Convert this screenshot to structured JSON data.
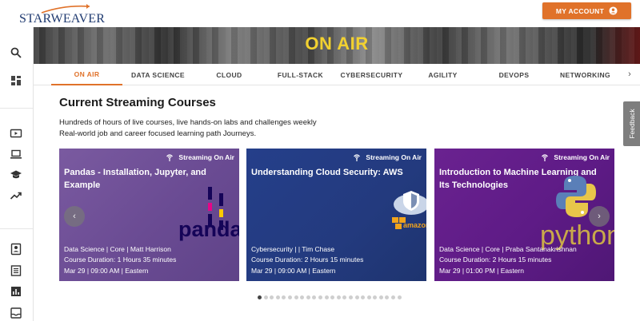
{
  "header": {
    "logo_text": "STARWEAVER",
    "account_label": "MY ACCOUNT"
  },
  "banner": {
    "title": "ON AIR"
  },
  "tabs": [
    {
      "label": "ON AIR",
      "active": true
    },
    {
      "label": "DATA SCIENCE"
    },
    {
      "label": "CLOUD"
    },
    {
      "label": "FULL-STACK"
    },
    {
      "label": "CYBERSECURITY"
    },
    {
      "label": "AGILITY"
    },
    {
      "label": "DEVOPS"
    },
    {
      "label": "NETWORKING"
    }
  ],
  "section": {
    "title": "Current Streaming Courses",
    "description": [
      "Hundreds of hours of live courses, live hands-on labs and challenges weekly",
      "Real-world job and career focused learning path Journeys."
    ]
  },
  "cards": [
    {
      "badge": "Streaming On Air",
      "title": "Pandas - Installation, Jupyter, and Example",
      "art_text": "pandas",
      "meta": [
        "Data Science | Core | Matt Harrison",
        "Course Duration: 1 Hours 35 minutes",
        "Mar 29 | 09:00 AM | Eastern"
      ]
    },
    {
      "badge": "Streaming On Air",
      "title": "Understanding Cloud Security: AWS",
      "art_text": "amazon web services",
      "meta": [
        "Cybersecurity | | Tim Chase",
        "Course Duration: 2 Hours 15 minutes",
        "Mar 29 | 09:00 AM | Eastern"
      ]
    },
    {
      "badge": "Streaming On Air",
      "title": "Introduction to Machine Learning and Its Technologies",
      "art_text": "python",
      "meta": [
        "Data Science | Core | Praba Santanakrishnan",
        "Course Duration: 2 Hours 15 minutes",
        "Mar 29 | 01:00 PM | Eastern"
      ]
    }
  ],
  "carousel": {
    "dot_count": 24,
    "active_index": 0,
    "prev_glyph": "‹",
    "next_glyph": "›"
  },
  "feedback_label": "Feedback",
  "colors": {
    "accent": "#e0722a",
    "banner_title": "#f2d130"
  },
  "rail_icons": [
    "search-icon",
    "dashboard-icon",
    "live-tv-icon",
    "laptop-icon",
    "school-icon",
    "trending-icon",
    "contact-icon",
    "list-icon",
    "chart-icon",
    "inbox-icon"
  ]
}
